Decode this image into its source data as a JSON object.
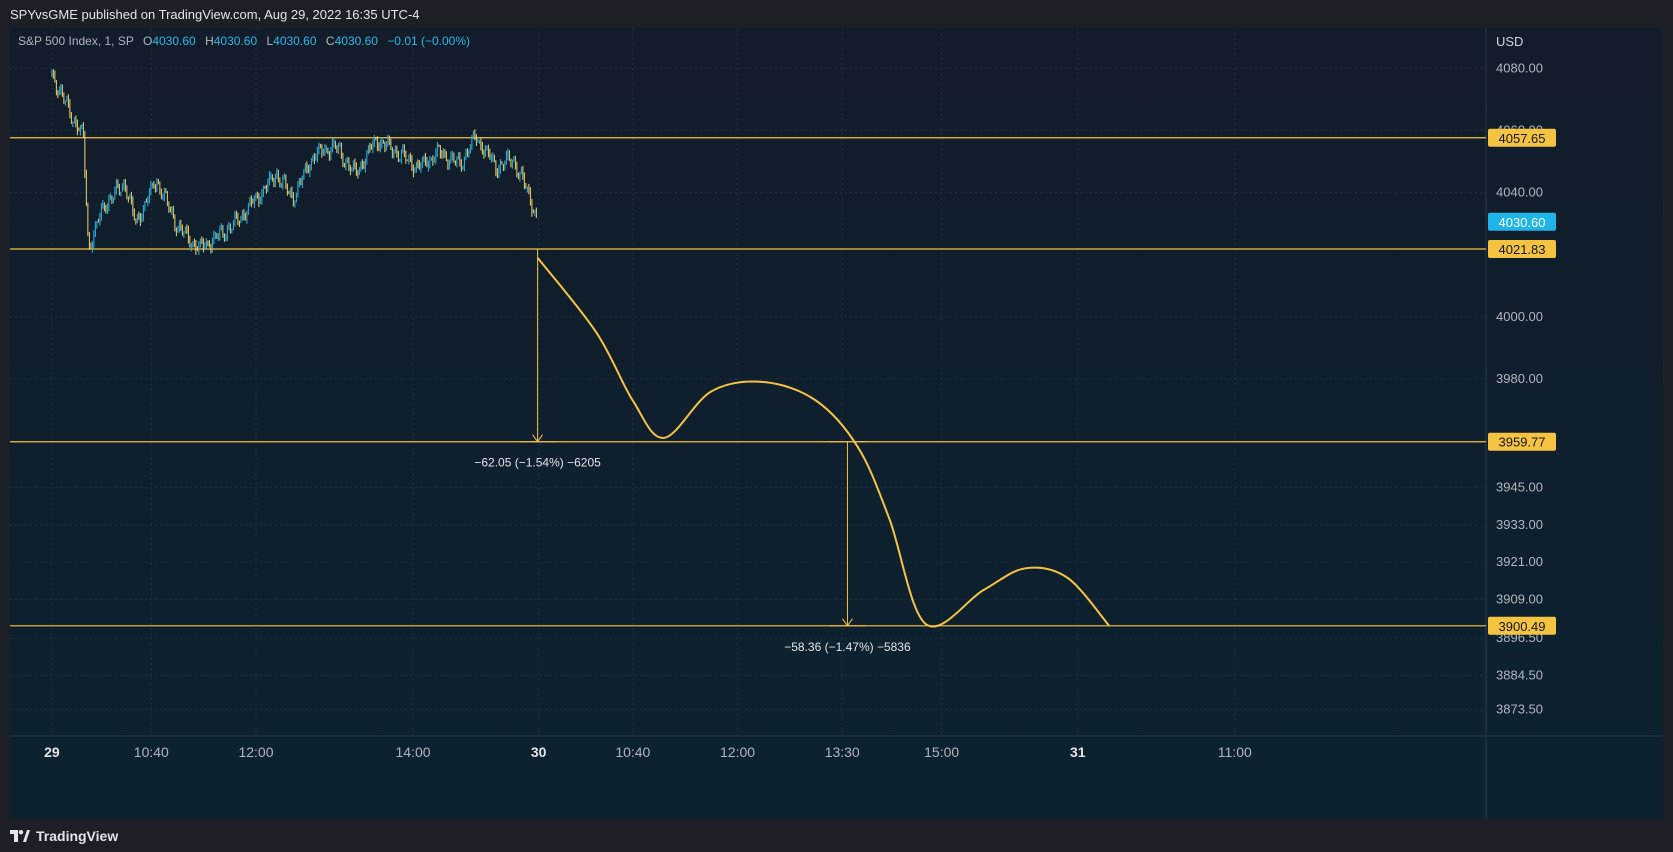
{
  "header": {
    "published": "SPYvsGME published on TradingView.com, Aug 29, 2022 16:35 UTC-4"
  },
  "legend": {
    "symbol": "S&P 500 Index, 1, SP",
    "o_label": "O",
    "o_value": "4030.60",
    "h_label": "H",
    "h_value": "4030.60",
    "l_label": "L",
    "l_value": "4030.60",
    "c_label": "C",
    "c_value": "4030.60",
    "change": "−0.01 (−0.00%)"
  },
  "currency": "USD",
  "footer": {
    "brand": "TradingView",
    "logo_icon": "tradingview-logo-icon"
  },
  "colors": {
    "chart_bg_top": "#121c2a",
    "chart_bg_bottom": "#0c2230",
    "grid": "#1f3040",
    "level_line": "#f5c342",
    "last_price_badge": "#1fb5e8",
    "candle_up": "#2fb7e8",
    "candle_down": "#f0d56c",
    "axis_text": "#b2b5be"
  },
  "chart_data": {
    "type": "candlestick",
    "title": "S&P 500 Index, 1, SP",
    "ylabel": "USD",
    "ylim": [
      3865,
      4093
    ],
    "y_ticks": [
      "4080.00",
      "4060.00",
      "4040.00",
      "4000.00",
      "3980.00",
      "3945.00",
      "3933.00",
      "3921.00",
      "3909.00",
      "3896.50",
      "3884.50",
      "3873.50"
    ],
    "x_ticks": [
      {
        "label": "29",
        "bold": true
      },
      {
        "label": "10:40",
        "bold": false
      },
      {
        "label": "12:00",
        "bold": false
      },
      {
        "label": "14:00",
        "bold": false
      },
      {
        "label": "30",
        "bold": true
      },
      {
        "label": "10:40",
        "bold": false
      },
      {
        "label": "12:00",
        "bold": false
      },
      {
        "label": "13:30",
        "bold": false
      },
      {
        "label": "15:00",
        "bold": false
      },
      {
        "label": "31",
        "bold": true
      },
      {
        "label": "11:00",
        "bold": false
      }
    ],
    "horizontal_levels": [
      4057.65,
      4021.83,
      3959.77,
      3900.49
    ],
    "last_price": 4030.6,
    "price_path": [
      {
        "t": 0.0,
        "p": 4078
      },
      {
        "t": 0.1,
        "p": 4071
      },
      {
        "t": 0.2,
        "p": 4064
      },
      {
        "t": 0.3,
        "p": 4058
      },
      {
        "t": 0.35,
        "p": 4022
      },
      {
        "t": 0.5,
        "p": 4036
      },
      {
        "t": 0.7,
        "p": 4043
      },
      {
        "t": 0.8,
        "p": 4030
      },
      {
        "t": 1.0,
        "p": 4044
      },
      {
        "t": 1.2,
        "p": 4029
      },
      {
        "t": 1.4,
        "p": 4022
      },
      {
        "t": 1.55,
        "p": 4025
      },
      {
        "t": 1.75,
        "p": 4030
      },
      {
        "t": 2.0,
        "p": 4040
      },
      {
        "t": 2.15,
        "p": 4046
      },
      {
        "t": 2.3,
        "p": 4038
      },
      {
        "t": 2.5,
        "p": 4052
      },
      {
        "t": 2.7,
        "p": 4055
      },
      {
        "t": 2.9,
        "p": 4046
      },
      {
        "t": 3.1,
        "p": 4057
      },
      {
        "t": 3.3,
        "p": 4053
      },
      {
        "t": 3.5,
        "p": 4048
      },
      {
        "t": 3.7,
        "p": 4053
      },
      {
        "t": 3.9,
        "p": 4049
      },
      {
        "t": 4.05,
        "p": 4058
      },
      {
        "t": 4.25,
        "p": 4048
      },
      {
        "t": 4.4,
        "p": 4051
      },
      {
        "t": 4.55,
        "p": 4040
      },
      {
        "t": 4.64,
        "p": 4031
      }
    ],
    "projection_path": [
      {
        "t": 4.64,
        "p": 4019
      },
      {
        "t": 5.2,
        "p": 3995
      },
      {
        "t": 5.55,
        "p": 3973
      },
      {
        "t": 5.85,
        "p": 3961
      },
      {
        "t": 6.3,
        "p": 3976
      },
      {
        "t": 6.8,
        "p": 3979
      },
      {
        "t": 7.3,
        "p": 3973
      },
      {
        "t": 7.7,
        "p": 3958
      },
      {
        "t": 8.0,
        "p": 3935
      },
      {
        "t": 8.35,
        "p": 3901
      },
      {
        "t": 8.9,
        "p": 3912
      },
      {
        "t": 9.3,
        "p": 3919
      },
      {
        "t": 9.7,
        "p": 3916
      },
      {
        "t": 10.1,
        "p": 3900.49
      }
    ],
    "measurements": [
      {
        "t": 4.64,
        "from": 4021.83,
        "to": 3959.77,
        "label": "−62.05 (−1.54%) −6205"
      },
      {
        "t": 7.6,
        "from": 3959.77,
        "to": 3900.49,
        "label": "−58.36 (−1.47%) −5836"
      }
    ]
  }
}
